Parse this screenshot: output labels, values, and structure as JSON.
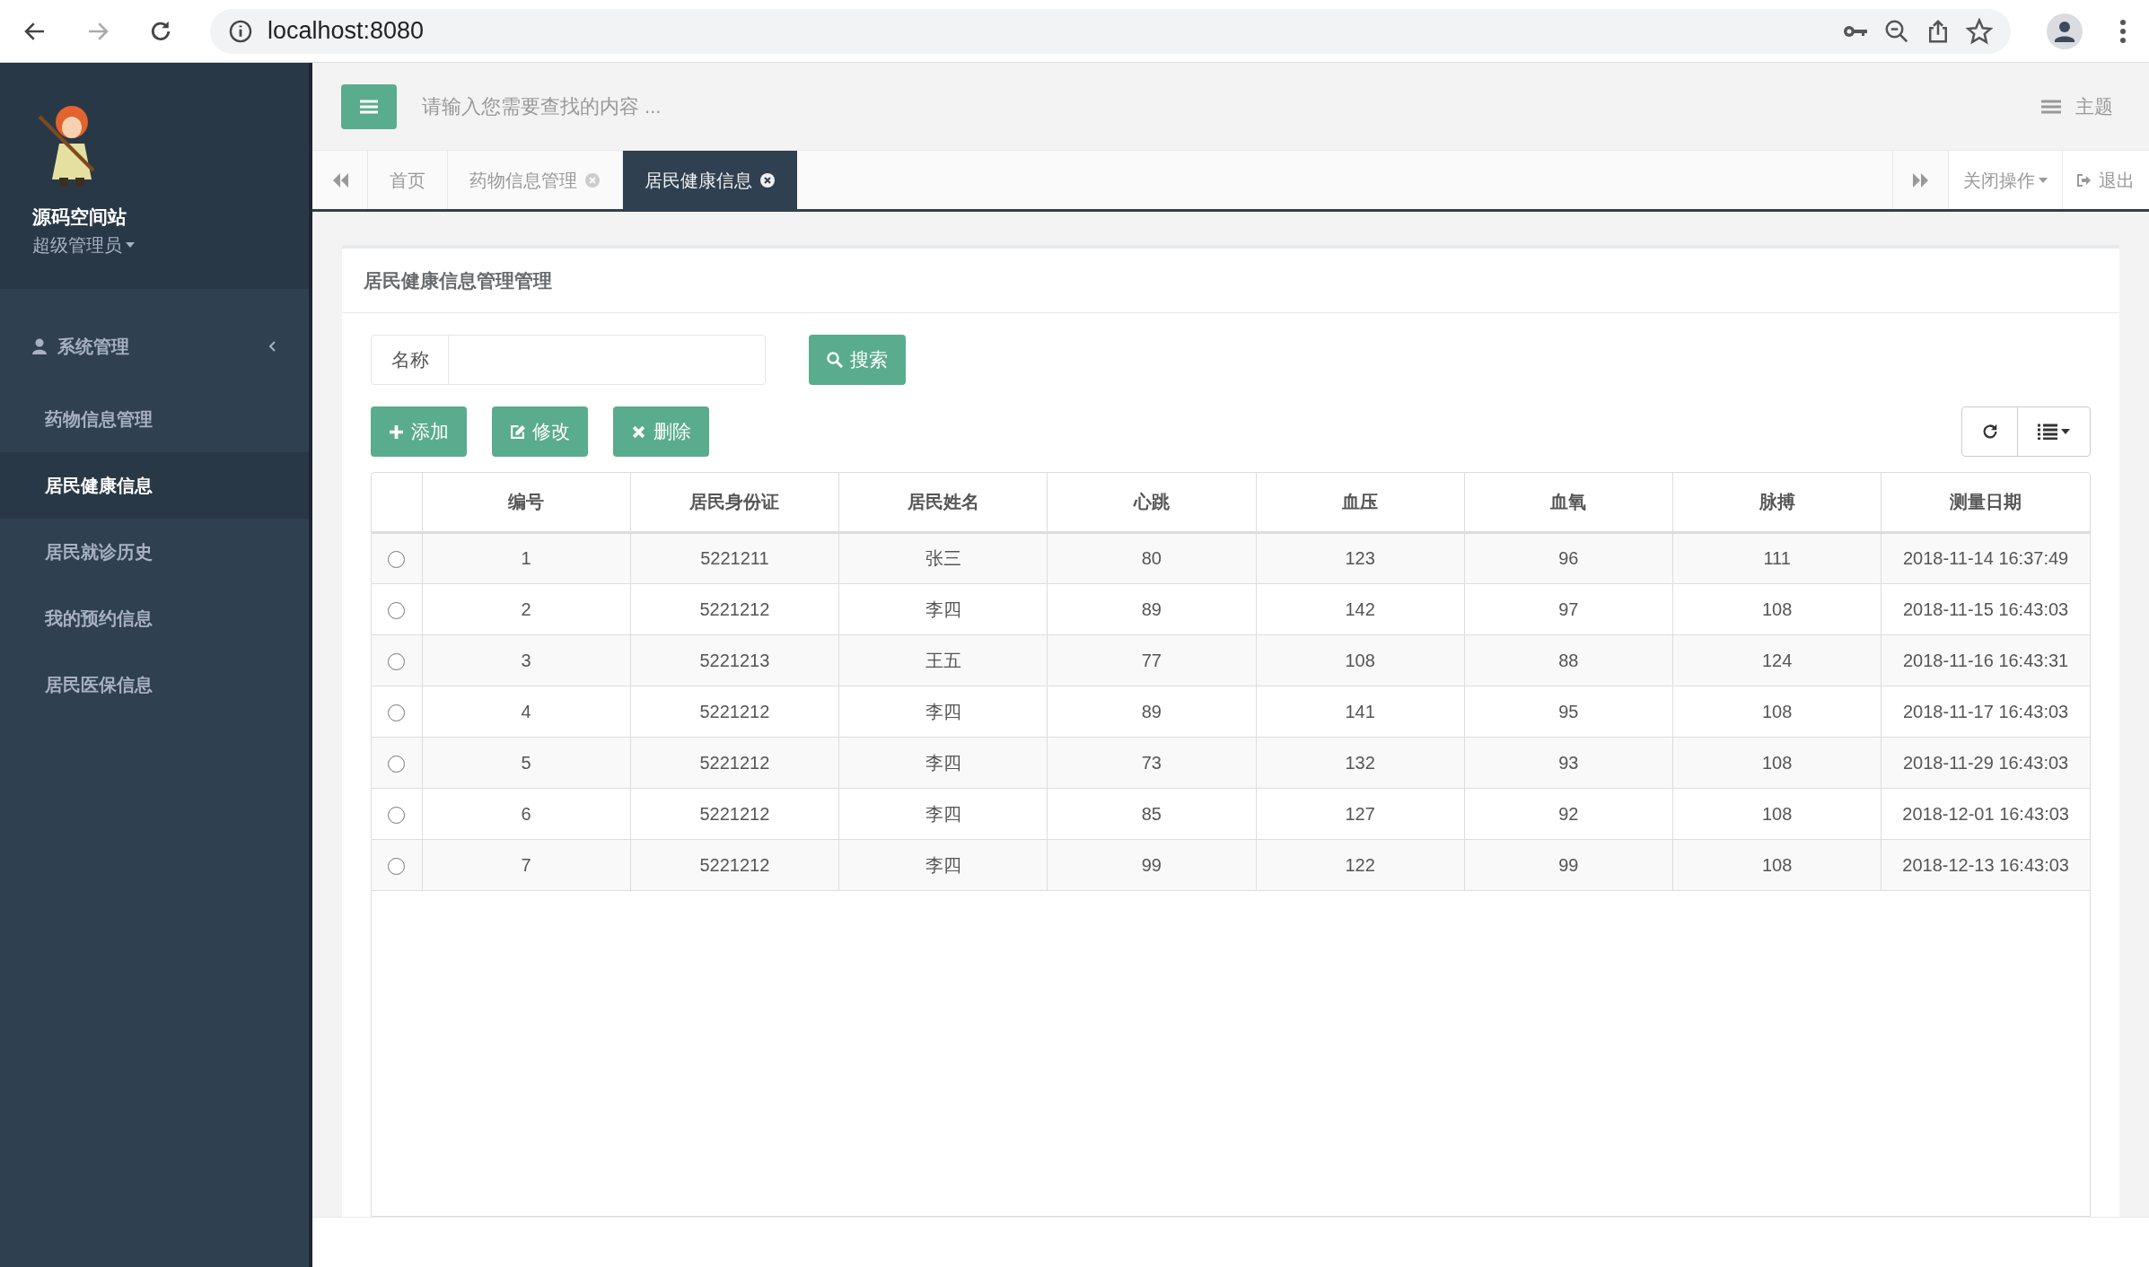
{
  "browser": {
    "url": "localhost:8080"
  },
  "sidebar": {
    "site_name": "源码空间站",
    "role": "超级管理员",
    "group": {
      "label": "系统管理",
      "expanded": true,
      "items": [
        {
          "label": "药物信息管理",
          "selected": false
        },
        {
          "label": "居民健康信息",
          "selected": true
        },
        {
          "label": "居民就诊历史",
          "selected": false
        },
        {
          "label": "我的预约信息",
          "selected": false
        },
        {
          "label": "居民医保信息",
          "selected": false
        }
      ]
    }
  },
  "topbar": {
    "search_placeholder": "请输入您需要查找的内容 ...",
    "theme": "主题"
  },
  "tabs": [
    {
      "label": "首页",
      "closable": false,
      "selected": false
    },
    {
      "label": "药物信息管理",
      "closable": true,
      "selected": false
    },
    {
      "label": "居民健康信息",
      "closable": true,
      "selected": true
    }
  ],
  "tab_actions": {
    "close_ops": "关闭操作",
    "logout": "退出"
  },
  "panel": {
    "title": "居民健康信息管理管理",
    "filter_label": "名称",
    "search_button": "搜索",
    "buttons": [
      {
        "kind": "add",
        "label": "添加"
      },
      {
        "kind": "edit",
        "label": "修改"
      },
      {
        "kind": "delete",
        "label": "删除"
      }
    ]
  },
  "table": {
    "columns": [
      "编号",
      "居民身份证",
      "居民姓名",
      "心跳",
      "血压",
      "血氧",
      "脉搏",
      "测量日期"
    ],
    "rows": [
      {
        "selected": false,
        "cells": [
          "1",
          "5221211",
          "张三",
          "80",
          "123",
          "96",
          "111",
          "2018-11-14 16:37:49"
        ]
      },
      {
        "selected": false,
        "cells": [
          "2",
          "5221212",
          "李四",
          "89",
          "142",
          "97",
          "108",
          "2018-11-15 16:43:03"
        ]
      },
      {
        "selected": false,
        "cells": [
          "3",
          "5221213",
          "王五",
          "77",
          "108",
          "88",
          "124",
          "2018-11-16 16:43:31"
        ]
      },
      {
        "selected": false,
        "cells": [
          "4",
          "5221212",
          "李四",
          "89",
          "141",
          "95",
          "108",
          "2018-11-17 16:43:03"
        ]
      },
      {
        "selected": false,
        "cells": [
          "5",
          "5221212",
          "李四",
          "73",
          "132",
          "93",
          "108",
          "2018-11-29 16:43:03"
        ]
      },
      {
        "selected": false,
        "cells": [
          "6",
          "5221212",
          "李四",
          "85",
          "127",
          "92",
          "108",
          "2018-12-01 16:43:03"
        ]
      },
      {
        "selected": false,
        "cells": [
          "7",
          "5221212",
          "李四",
          "99",
          "122",
          "99",
          "108",
          "2018-12-13 16:43:03"
        ]
      }
    ]
  }
}
